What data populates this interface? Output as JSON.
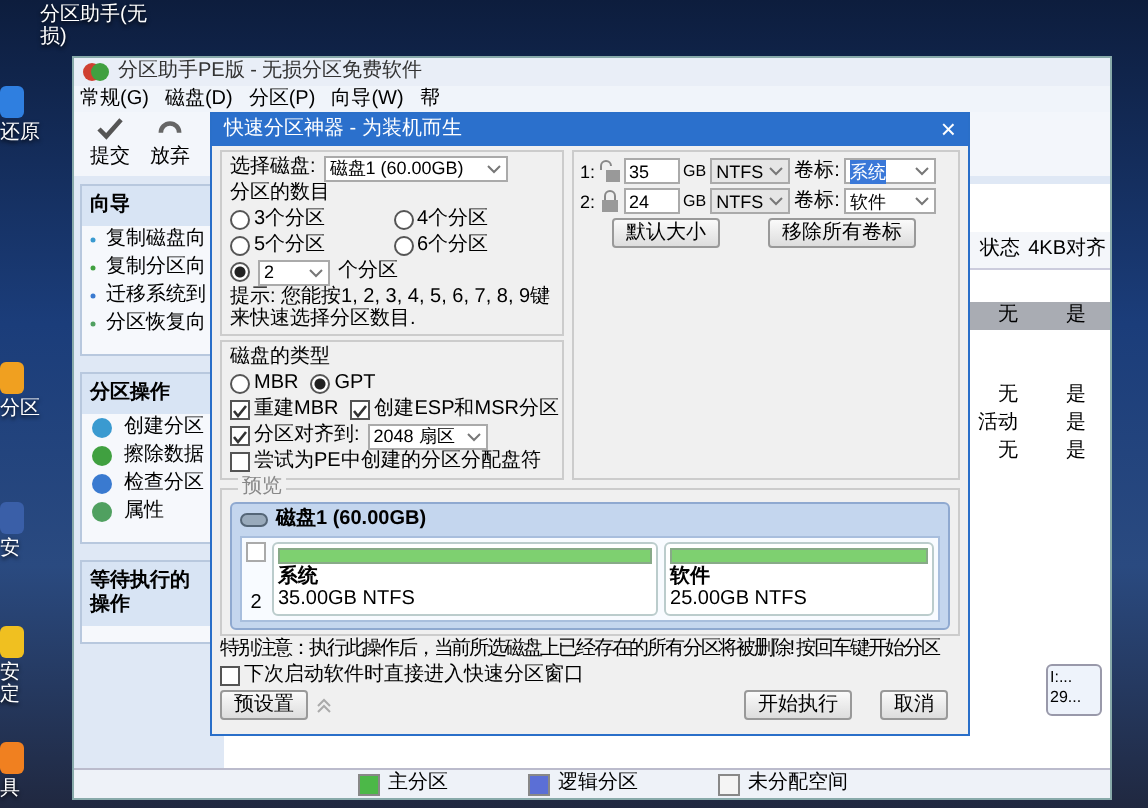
{
  "desktop_icons": [
    {
      "label": "分区助手(无损)"
    },
    {
      "label": "还原"
    },
    {
      "label": "分区"
    },
    {
      "label": "安"
    },
    {
      "label": "安定"
    },
    {
      "label": "具"
    }
  ],
  "main_window": {
    "title": "分区助手PE版 - 无损分区免费软件",
    "menu": [
      "常规(G)",
      "磁盘(D)",
      "分区(P)",
      "向导(W)",
      "帮"
    ],
    "toolbar": [
      {
        "label": "提交"
      },
      {
        "label": "放弃"
      }
    ],
    "sidebar": [
      {
        "title": "向导",
        "items": [
          "复制磁盘向",
          "复制分区向",
          "迁移系统到",
          "分区恢复向"
        ]
      },
      {
        "title": "分区操作",
        "items": [
          "创建分区",
          "擦除数据",
          "检查分区",
          "属性"
        ]
      },
      {
        "title": "等待执行的操作"
      }
    ],
    "table": {
      "columns": [
        "状态",
        "4KB对齐"
      ],
      "groups": [
        {
          "rows": [
            {
              "status": "无",
              "aligned": "是",
              "selected": true
            }
          ]
        },
        {
          "rows": [
            {
              "status": "无",
              "aligned": "是",
              "selected": false
            },
            {
              "status": "活动",
              "aligned": "是",
              "selected": false
            },
            {
              "status": "无",
              "aligned": "是",
              "selected": false
            }
          ]
        }
      ]
    },
    "disk_card": {
      "line_1": "I:...",
      "line_2": "29..."
    },
    "legend": [
      {
        "label": "主分区",
        "color": "#4cb848"
      },
      {
        "label": "逻辑分区",
        "color": "#5b6fd6"
      },
      {
        "label": "未分配空间",
        "color": "#f4f4f4"
      }
    ]
  },
  "dialog": {
    "title": "快速分区神器 - 为装机而生",
    "close": "×",
    "disk_label": "选择磁盘:",
    "disk_value": "磁盘1 (60.00GB)",
    "count_title": "分区的数目",
    "count_options": [
      {
        "label": "3个分区",
        "selected": false
      },
      {
        "label": "4个分区",
        "selected": false
      },
      {
        "label": "5个分区",
        "selected": false
      },
      {
        "label": "6个分区",
        "selected": false
      }
    ],
    "custom_count": {
      "value": "2",
      "suffix": "个分区",
      "selected": true
    },
    "hint": "提示: 您能按1, 2, 3, 4, 5, 6, 7, 8, 9键来快速选择分区数目.",
    "type_title": "磁盘的类型",
    "type_options": [
      {
        "label": "MBR",
        "selected": false
      },
      {
        "label": "GPT",
        "selected": true
      }
    ],
    "checks": [
      {
        "label": "重建MBR",
        "checked": true
      },
      {
        "label": "创建ESP和MSR分区",
        "checked": true
      }
    ],
    "align": {
      "label": "分区对齐到:",
      "checked": true,
      "value": "2048 扇区"
    },
    "assign": {
      "label": "尝试为PE中创建的分区分配盘符",
      "checked": false
    },
    "partitions": [
      {
        "index": "1:",
        "locked": false,
        "size": "35",
        "unit": "GB",
        "fs": "NTFS",
        "caption": "卷标:",
        "label": "系统",
        "label_selected": true
      },
      {
        "index": "2:",
        "locked": true,
        "size": "24",
        "unit": "GB",
        "fs": "NTFS",
        "caption": "卷标:",
        "label": "软件",
        "label_selected": false
      }
    ],
    "default_size_button": "默认大小",
    "remove_labels_button": "移除所有卷标",
    "preview_title": "预览",
    "preview_disk": "磁盘1 (60.00GB)",
    "preview_count": "2",
    "preview_checked": false,
    "preview_partitions": [
      {
        "name": "系统",
        "detail": "35.00GB NTFS"
      },
      {
        "name": "软件",
        "detail": "25.00GB NTFS"
      }
    ],
    "warning": "特别注意：执行此操作后，当前所选磁盘上已经存在的所有分区将被删除! 按回车键开始分区",
    "next_start": {
      "label": "下次启动软件时直接进入快速分区窗口",
      "checked": false
    },
    "buttons": [
      "预设置",
      "开始执行",
      "取消"
    ]
  }
}
